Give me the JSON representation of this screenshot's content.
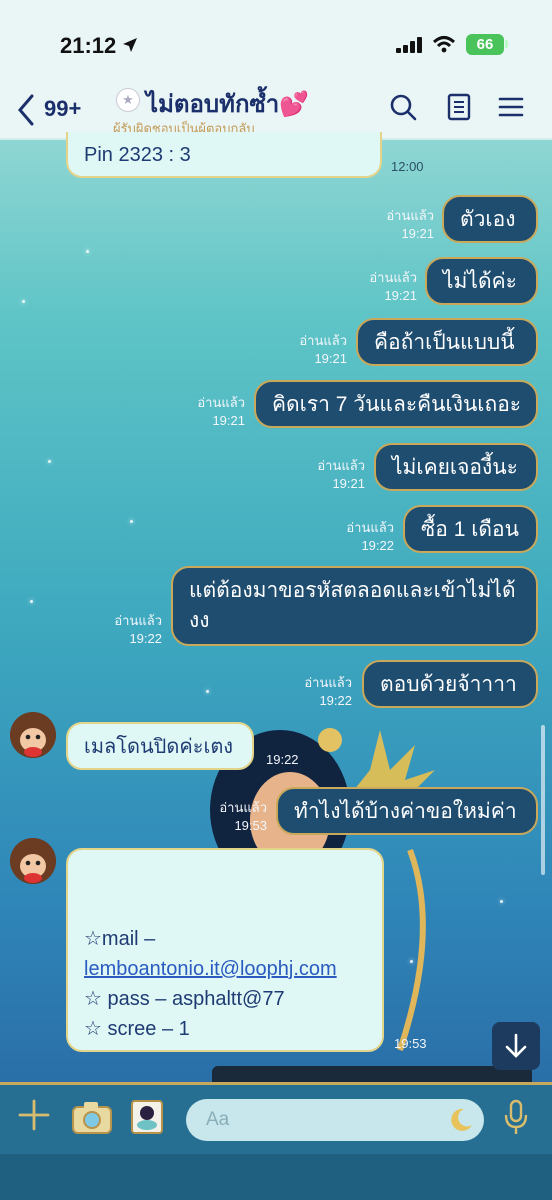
{
  "status_bar": {
    "time": "21:12",
    "battery": "66"
  },
  "header": {
    "back_count": "99+",
    "title": "ไม่ตอบทักซ้ำ💕",
    "subtitle": "ผู้รับผิดชอบเป็นผู้ตอบกลับ"
  },
  "messages": {
    "m0": {
      "text": "Pin ‫3 : 2323",
      "time": "12:00"
    },
    "m1": {
      "text": "ตัวเอง",
      "read": "อ่านแล้ว",
      "time": "19:21"
    },
    "m2": {
      "text": "ไม่ได้ค่ะ",
      "read": "อ่านแล้ว",
      "time": "19:21"
    },
    "m3": {
      "text": "คือถ้าเป็นแบบนี้",
      "read": "อ่านแล้ว",
      "time": "19:21"
    },
    "m4": {
      "text": "คิดเรา 7 วันและคืนเงินเถอะ",
      "read": "อ่านแล้ว",
      "time": "19:21"
    },
    "m5": {
      "text": "ไม่เคยเจองี้นะ",
      "read": "อ่านแล้ว",
      "time": "19:21"
    },
    "m6": {
      "text": "ซื้อ 1 เดือน",
      "read": "อ่านแล้ว",
      "time": "19:22"
    },
    "m7": {
      "line1": "แต่ต้องมาขอรหัสตลอดและเข้าไม่ได้",
      "line2": "งง",
      "read": "อ่านแล้ว",
      "time": "19:22"
    },
    "m8": {
      "text": "ตอบด้วยจ้าาาา",
      "read": "อ่านแล้ว",
      "time": "19:22"
    },
    "m9": {
      "text": "เมลโดนปิดค่ะเตง",
      "time": "19:22"
    },
    "m10": {
      "text": "ทำไงได้บ้างค่าขอใหม่ค่า",
      "read": "อ่านแล้ว",
      "time": "19:53"
    },
    "m11": {
      "mail_label": "☆mail – ",
      "mail_link": "lemboantonio.it@loophj.com",
      "pass": "☆ pass – asphaltt@77",
      "scree": "☆ scree – 1",
      "time": "19:53"
    }
  },
  "input": {
    "placeholder": "Aa"
  },
  "colors": {
    "sent_bubble": "#1f4d70",
    "received_bubble": "#dff8f5",
    "accent_gold": "#c9a85a",
    "header_text": "#1b2f6b"
  }
}
